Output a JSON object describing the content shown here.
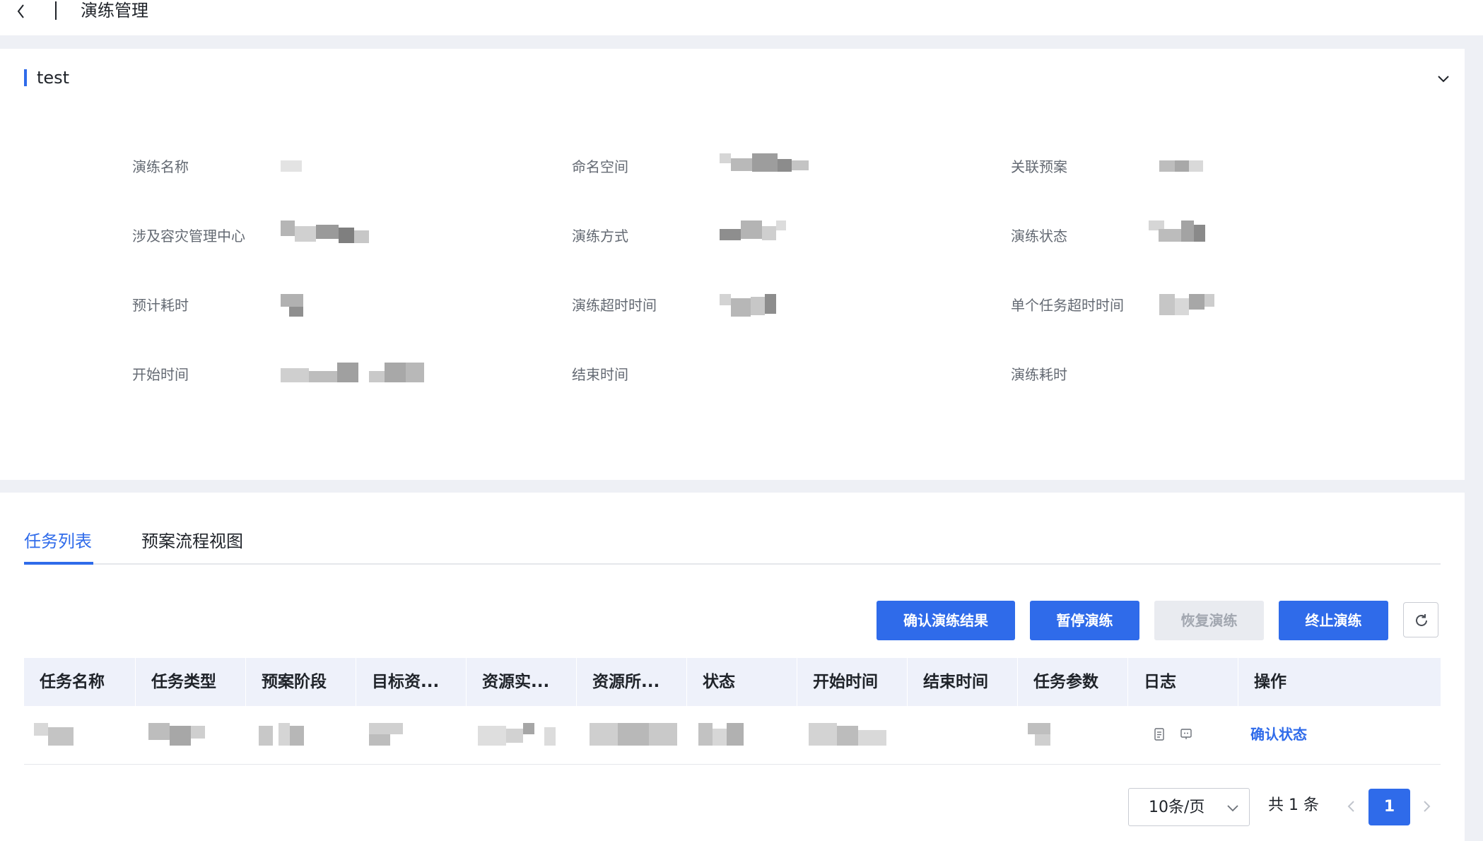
{
  "header": {
    "title": "演练管理"
  },
  "plan": {
    "name": "test",
    "fields": [
      {
        "label": "演练名称"
      },
      {
        "label": "命名空间"
      },
      {
        "label": "关联预案"
      },
      {
        "label": "涉及容灾管理中心"
      },
      {
        "label": "演练方式"
      },
      {
        "label": "演练状态"
      },
      {
        "label": "预计耗时"
      },
      {
        "label": "演练超时时间"
      },
      {
        "label": "单个任务超时时间"
      },
      {
        "label": "开始时间"
      },
      {
        "label": "结束时间"
      },
      {
        "label": "演练耗时"
      }
    ]
  },
  "tabs": [
    {
      "label": "任务列表",
      "active": true
    },
    {
      "label": "预案流程视图",
      "active": false
    }
  ],
  "toolbar": {
    "confirm_result": "确认演练结果",
    "pause": "暂停演练",
    "resume": "恢复演练",
    "stop": "终止演练"
  },
  "table": {
    "columns": [
      "任务名称",
      "任务类型",
      "预案阶段",
      "目标资...",
      "资源实...",
      "资源所...",
      "状态",
      "开始时间",
      "结束时间",
      "任务参数",
      "日志",
      "操作"
    ],
    "rows": [
      {
        "action": "确认状态"
      }
    ]
  },
  "pagination": {
    "page_size": "10条/页",
    "total": "共 1 条",
    "current_page": "1"
  },
  "colors": {
    "accent": "#2f6bea",
    "background": "#eef0f5",
    "table_header": "#eef1fa",
    "disabled_button": "#e9ebf0"
  }
}
